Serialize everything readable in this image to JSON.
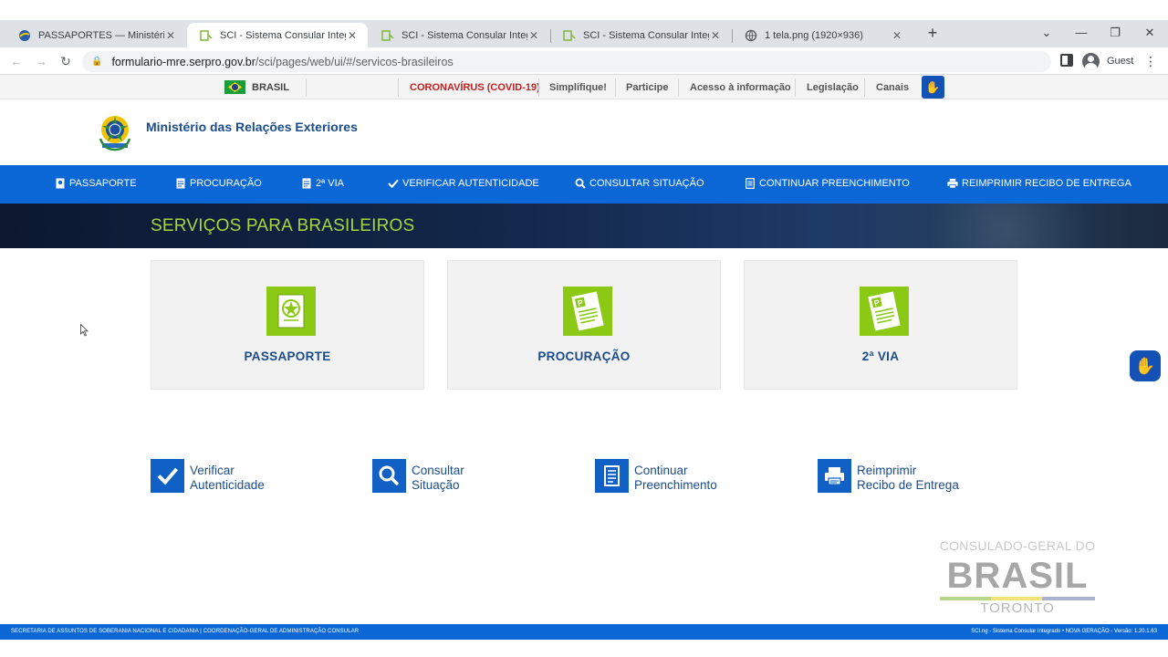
{
  "browser": {
    "tabs": [
      {
        "title": "PASSAPORTES — Ministério das R",
        "active": false,
        "icon": "flag-favicon"
      },
      {
        "title": "SCI - Sistema Consular Integrado",
        "active": true,
        "icon": "sci-favicon"
      },
      {
        "title": "SCI - Sistema Consular Integrado",
        "active": false,
        "icon": "sci-favicon"
      },
      {
        "title": "SCI - Sistema Consular Integrado",
        "active": false,
        "icon": "sci-favicon"
      },
      {
        "title": "1 tela.png (1920×936)",
        "active": false,
        "icon": "globe-favicon"
      }
    ],
    "url_host": "formulario-mre.serpro.gov.br",
    "url_path": "/sci/pages/web/ui/#/servicos-brasileiros",
    "profile": "Guest"
  },
  "govbar": {
    "country": "BRASIL",
    "links": [
      "CORONAVÍRUS (COVID-19)",
      "Simplifique!",
      "Participe",
      "Acesso à informação",
      "Legislação",
      "Canais"
    ]
  },
  "header": {
    "ministry": "Ministério das Relações Exteriores"
  },
  "menu": {
    "items": [
      {
        "label": "PASSAPORTE",
        "icon": "passport-icon"
      },
      {
        "label": "PROCURAÇÃO",
        "icon": "document-icon"
      },
      {
        "label": "2ª VIA",
        "icon": "document-icon"
      },
      {
        "label": "VERIFICAR AUTENTICIDADE",
        "icon": "checkmark-icon"
      },
      {
        "label": "CONSULTAR SITUAÇÃO",
        "icon": "search-icon"
      },
      {
        "label": "CONTINUAR PREENCHIMENTO",
        "icon": "form-icon"
      },
      {
        "label": "REIMPRIMIR RECIBO DE ENTREGA",
        "icon": "printer-icon"
      }
    ]
  },
  "banner": {
    "title": "SERVIÇOS PARA BRASILEIROS"
  },
  "cards": [
    {
      "label": "PASSAPORTE",
      "icon": "passport-icon"
    },
    {
      "label": "PROCURAÇÃO",
      "icon": "document-p-icon"
    },
    {
      "label": "2ª VIA",
      "icon": "document-p-icon"
    }
  ],
  "quick_links": [
    {
      "line1": "Verificar",
      "line2": "Autenticidade",
      "icon": "checkmark-icon"
    },
    {
      "line1": "Consultar",
      "line2": "Situação",
      "icon": "search-icon"
    },
    {
      "line1": "Continuar",
      "line2": "Preenchimento",
      "icon": "form-icon"
    },
    {
      "line1": "Reimprimir",
      "line2": "Recibo de Entrega",
      "icon": "printer-icon"
    }
  ],
  "watermark": {
    "line1": "CONSULADO-GERAL DO",
    "line2": "BRASIL",
    "line3": "TORONTO"
  },
  "footer": {
    "left": "SECRETARIA DE ASSUNTOS DE SOBERANIA NACIONAL E CIDADANIA | COORDENAÇÃO-GERAL DE ADMINISTRAÇÃO CONSULAR",
    "right": "SCI.ng - Sistema Consular Integrado • NOVA GERAÇÃO - Versão: 1.20.1.63"
  },
  "colors": {
    "menu_blue": "#0c67d6",
    "accent_green": "#8bc915",
    "title_green": "#a6d63c",
    "text_blue": "#1a4c8c"
  }
}
